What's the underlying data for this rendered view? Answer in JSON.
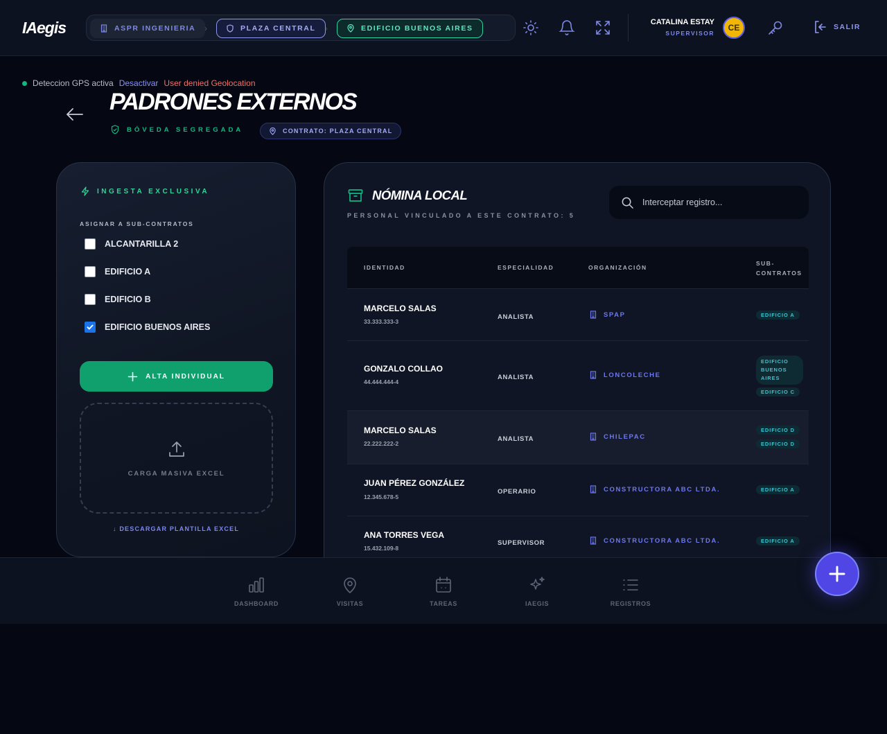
{
  "app": {
    "logo": "IAegis"
  },
  "breadcrumbs": [
    {
      "label": "ASPR INGENIERIA",
      "icon": "building-icon"
    },
    {
      "label": "PLAZA CENTRAL",
      "icon": "shield-icon"
    },
    {
      "label": "EDIFICIO BUENOS AIRES",
      "icon": "map-pin-icon"
    }
  ],
  "user": {
    "name": "CATALINA ESTAY",
    "role": "SUPERVISOR",
    "initials": "CE"
  },
  "toolbar": {
    "logout_label": "SALIR"
  },
  "gps": {
    "status": "Deteccion GPS activa",
    "toggle": "Desactivar",
    "error": "User denied Geolocation"
  },
  "page": {
    "title": "PADRONES EXTERNOS",
    "vault_label": "BÓVEDA SEGREGADA",
    "contract_pill": "CONTRATO: PLAZA CENTRAL"
  },
  "ingest": {
    "title": "INGESTA EXCLUSIVA",
    "assign_label": "ASIGNAR A SUB-CONTRATOS",
    "options": [
      {
        "label": "ALCANTARILLA 2",
        "checked": false
      },
      {
        "label": "EDIFICIO A",
        "checked": false
      },
      {
        "label": "EDIFICIO B",
        "checked": false
      },
      {
        "label": "EDIFICIO BUENOS AIRES",
        "checked": true
      }
    ],
    "alta_button": "ALTA INDIVIDUAL",
    "dropzone_label": "CARGA MASIVA EXCEL",
    "download_link": "↓ DESCARGAR PLANTILLA EXCEL"
  },
  "roster": {
    "title": "NÓMINA LOCAL",
    "subtitle": "PERSONAL VINCULADO A ESTE CONTRATO: 5",
    "search_placeholder": "Interceptar registro...",
    "columns": {
      "identity": "IDENTIDAD",
      "specialty": "ESPECIALIDAD",
      "organization": "ORGANIZACIÓN",
      "subcontracts": "SUB-\nCONTRATOS"
    },
    "rows": [
      {
        "name": "MARCELO SALAS",
        "rut": "33.333.333-3",
        "specialty": "ANALISTA",
        "org": "SPAP",
        "tags": [
          "EDIFICIO A"
        ]
      },
      {
        "name": "GONZALO COLLAO",
        "rut": "44.444.444-4",
        "specialty": "ANALISTA",
        "org": "LONCOLECHE",
        "tags": [
          "EDIFICIO BUENOS AIRES",
          "EDIFICIO C"
        ]
      },
      {
        "name": "MARCELO SALAS",
        "rut": "22.222.222-2",
        "specialty": "ANALISTA",
        "org": "CHILEPAC",
        "tags": [
          "EDIFICIO D",
          "EDIFICIO D"
        ]
      },
      {
        "name": "JUAN PÉREZ GONZÁLEZ",
        "rut": "12.345.678-5",
        "specialty": "OPERARIO",
        "org": "CONSTRUCTORA ABC LTDA.",
        "tags": [
          "EDIFICIO A"
        ]
      },
      {
        "name": "ANA TORRES VEGA",
        "rut": "15.432.109-8",
        "specialty": "SUPERVISOR",
        "org": "CONSTRUCTORA ABC LTDA.",
        "tags": [
          "EDIFICIO A"
        ]
      }
    ]
  },
  "nav": [
    {
      "label": "DASHBOARD",
      "icon": "bar-chart-icon"
    },
    {
      "label": "VISITAS",
      "icon": "map-pin-icon"
    },
    {
      "label": "TAREAS",
      "icon": "calendar-icon"
    },
    {
      "label": "IAEGIS",
      "icon": "sparkles-icon"
    },
    {
      "label": "REGISTROS",
      "icon": "list-icon"
    }
  ]
}
